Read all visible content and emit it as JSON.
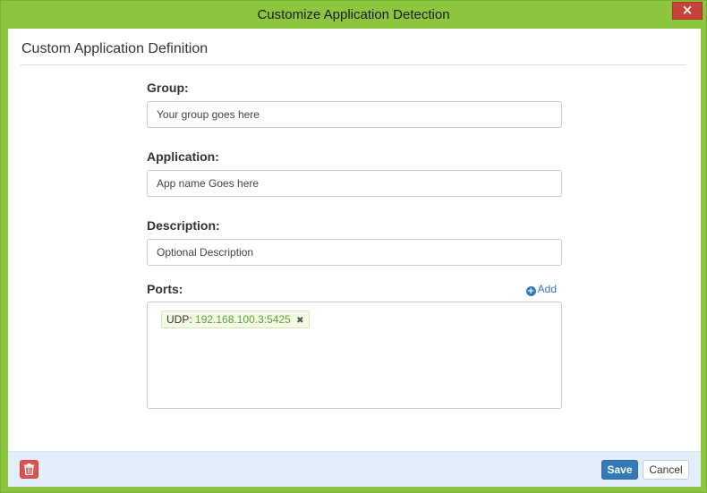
{
  "window": {
    "title": "Customize Application Detection",
    "close_glyph": "×"
  },
  "panel": {
    "title": "Custom Application Definition"
  },
  "form": {
    "group": {
      "label": "Group:",
      "value": "Your group goes here"
    },
    "application": {
      "label": "Application:",
      "value": "App name Goes here"
    },
    "description": {
      "label": "Description:",
      "value": "Optional Description"
    },
    "ports": {
      "label": "Ports:",
      "add_label": "Add",
      "add_icon": "plus-circle-icon",
      "tags": [
        {
          "protocol": "UDP:",
          "address": "192.168.100.3:5425",
          "remove_glyph": "✖"
        }
      ]
    }
  },
  "footer": {
    "delete_icon": "trash-icon",
    "save_label": "Save",
    "cancel_label": "Cancel"
  },
  "colors": {
    "window_frame": "#8cc63f",
    "primary": "#337ab7",
    "danger": "#d9534f",
    "footer_bg": "#e3eefb",
    "tag_text": "#5fa33a"
  }
}
